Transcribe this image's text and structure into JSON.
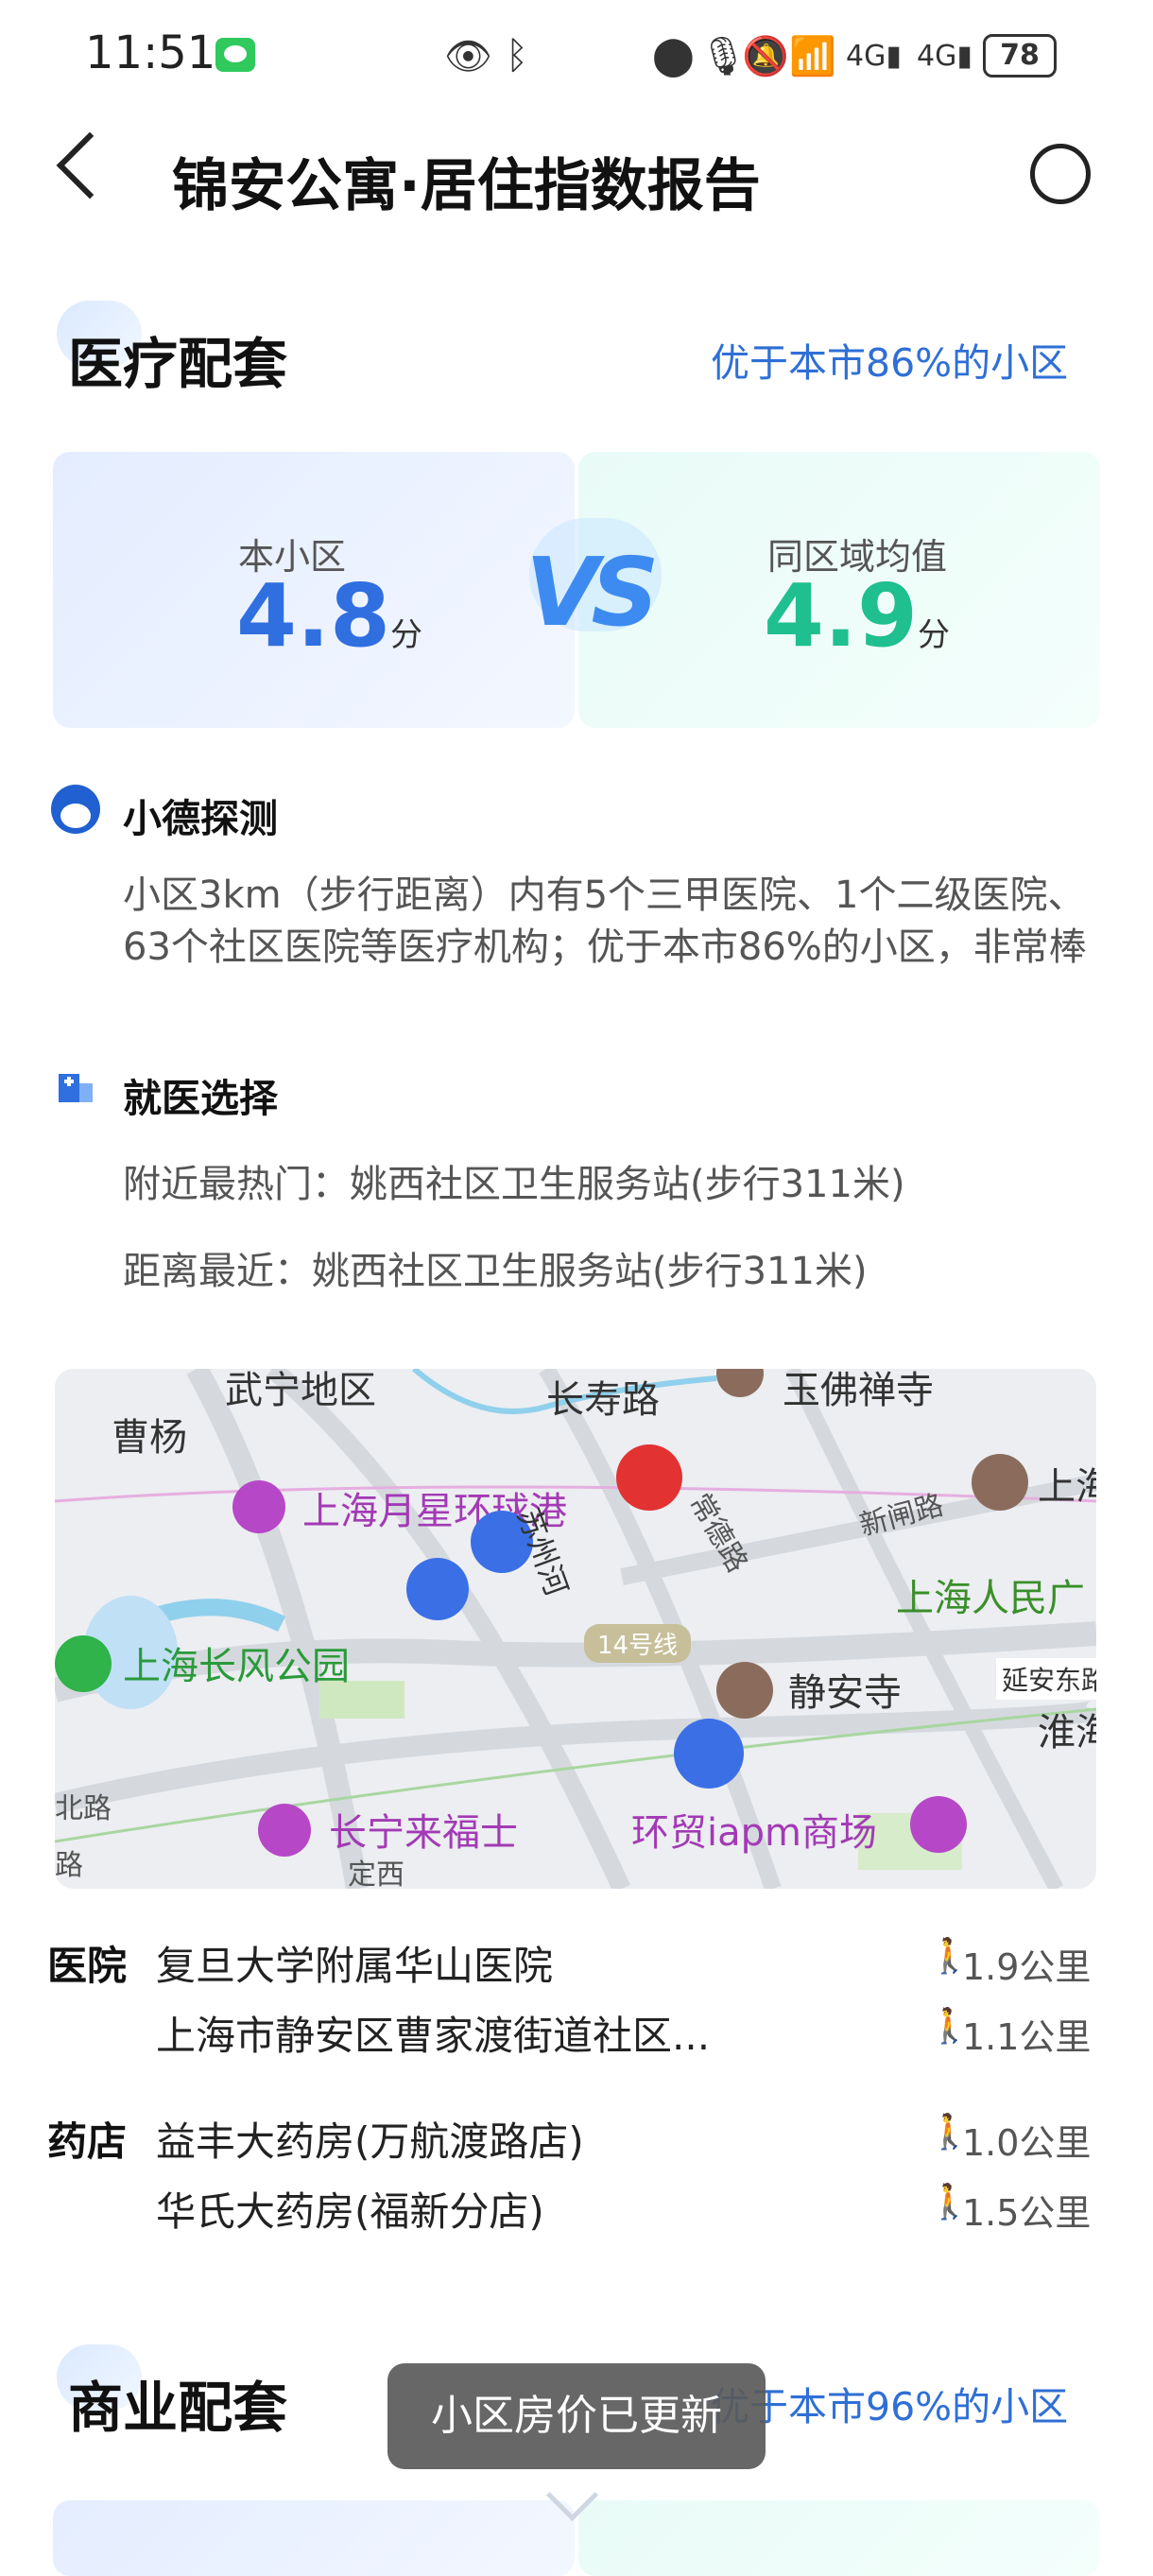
{
  "status_bar": {
    "time": "11:51",
    "battery": "78"
  },
  "header": {
    "title": "锦安公寓·居住指数报告"
  },
  "medical": {
    "title": "医疗配套",
    "rank": "优于本市86%的小区",
    "this_label": "本小区",
    "this_score": "4.8",
    "unit": "分",
    "vs": "VS",
    "avg_label": "同区域均值",
    "avg_score": "4.9",
    "detect_title": "小德探测",
    "detect_text": "小区3km（步行距离）内有5个三甲医院、1个二级医院、63个社区医院等医疗机构；优于本市86%的小区，非常棒",
    "choice_title": "就医选择",
    "hot_line": "附近最热门：姚西社区卫生服务站(步行311米)",
    "near_line": "距离最近：姚西社区卫生服务站(步行311米)"
  },
  "map": {
    "labels": {
      "wuning": "武宁地区",
      "caoyang": "曹杨",
      "changshou": "长寿路",
      "yufo": "玉佛禅寺",
      "yuexing": "上海月星环球港",
      "changde": "常德路",
      "xinzha": "新闸路",
      "shanghai": "上海",
      "renmin": "上海人民广",
      "changfeng": "上海长风公园",
      "line14": "14号线",
      "jingan": "静安寺",
      "yanan": "延安东路",
      "huaihai": "淮海",
      "laifu": "长宁来福士",
      "iapm": "环贸iapm商场",
      "dingxi": "定西",
      "road_left": "北路",
      "road_left2": "路",
      "suzhou": "苏州河"
    }
  },
  "list": {
    "hospital_label": "医院",
    "hospitals": [
      {
        "name": "复旦大学附属华山医院",
        "distance": "1.9公里"
      },
      {
        "name": "上海市静安区曹家渡街道社区...",
        "distance": "1.1公里"
      }
    ],
    "pharmacy_label": "药店",
    "pharmacies": [
      {
        "name": "益丰大药房(万航渡路店)",
        "distance": "1.0公里"
      },
      {
        "name": "华氏大药房(福新分店)",
        "distance": "1.5公里"
      }
    ]
  },
  "commercial": {
    "title": "商业配套",
    "rank": "优于本市96%的小区"
  },
  "toast": "小区房价已更新",
  "colors": {
    "accent": "#2f6fd6",
    "this_score": "#2f6fe0",
    "avg_score": "#1fbf8f"
  },
  "icons": [
    "back-arrow-icon",
    "share-icon",
    "walk-icon",
    "mascot-icon",
    "hospital-icon"
  ]
}
